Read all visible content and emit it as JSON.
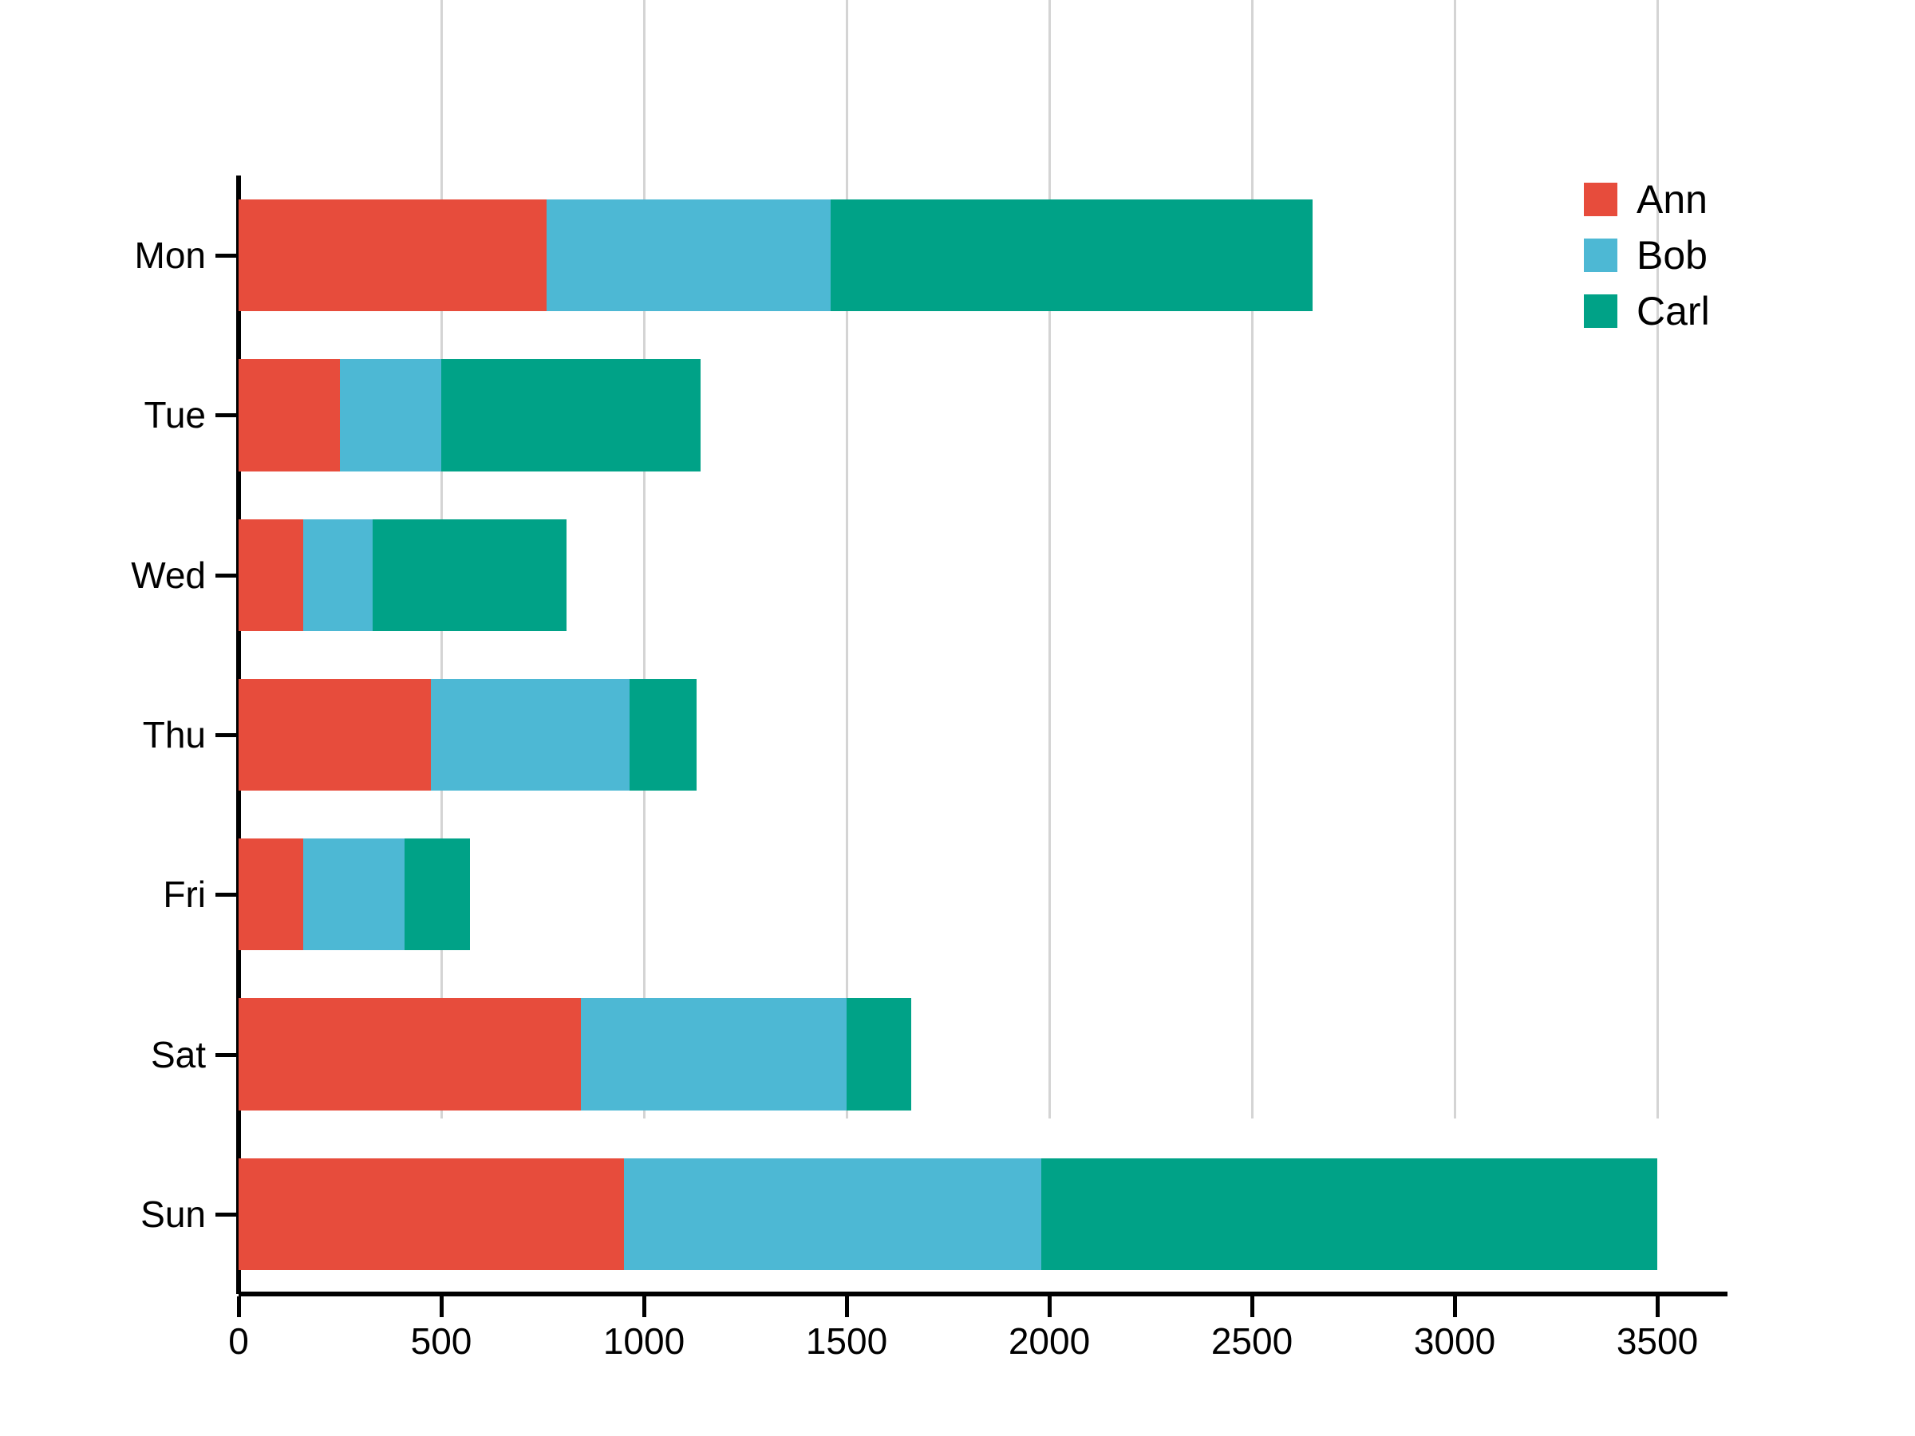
{
  "chart_data": {
    "type": "bar",
    "orientation": "horizontal",
    "stacked": true,
    "title": "",
    "xlabel": "",
    "ylabel": "",
    "categories": [
      "Mon",
      "Tue",
      "Wed",
      "Thu",
      "Fri",
      "Sat",
      "Sun"
    ],
    "series": [
      {
        "name": "Ann",
        "color": "#e74c3c",
        "values": [
          760,
          250,
          160,
          475,
          160,
          845,
          950
        ]
      },
      {
        "name": "Bob",
        "color": "#4db8d4",
        "values": [
          700,
          250,
          170,
          490,
          250,
          655,
          1030
        ]
      },
      {
        "name": "Carl",
        "color": "#00a287",
        "values": [
          1190,
          640,
          480,
          165,
          160,
          160,
          1520
        ]
      }
    ],
    "totals": [
      2650,
      1140,
      810,
      1130,
      570,
      1660,
      3500
    ],
    "xlim": [
      0,
      3500
    ],
    "xticks": [
      0,
      500,
      1000,
      1500,
      2000,
      2500,
      3000,
      3500
    ],
    "xtick_labels": [
      "0",
      "500",
      "1000",
      "1500",
      "2000",
      "2500",
      "3000",
      "3500"
    ],
    "grid": "vertical",
    "legend": {
      "position": "top-right",
      "entries": [
        "Ann",
        "Bob",
        "Carl"
      ]
    },
    "axis_color": "#000000",
    "gridline_color": "#d4d4d4",
    "background_color": "#ffffff"
  }
}
